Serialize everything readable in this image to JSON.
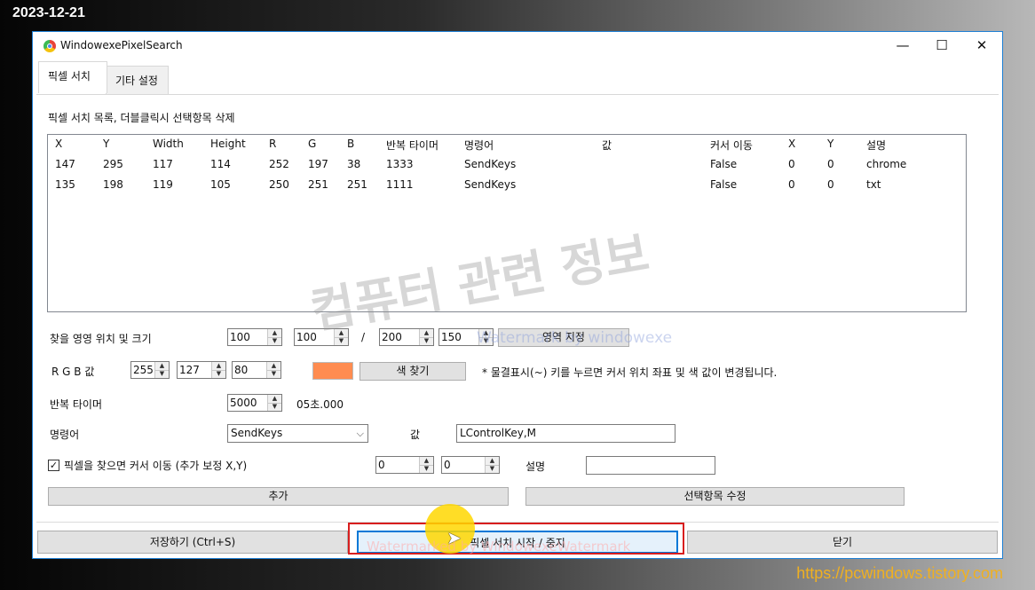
{
  "overlay": {
    "date": "2023-12-21",
    "site_url": "https://pcwindows.tistory.com",
    "watermark_main": "컴퓨터 관련 정보",
    "watermark_text_1": "Watermark by windowexe",
    "watermark_text_2": "Watermarked by WindowexeWatermark"
  },
  "window": {
    "title": "WindowexePixelSearch",
    "icon": "chrome-like-app-icon",
    "controls": {
      "minimize": "—",
      "maximize": "☐",
      "close": "✕"
    }
  },
  "tabs": [
    {
      "label": "픽셀 서치",
      "active": true
    },
    {
      "label": "기타 설정",
      "active": false
    }
  ],
  "main": {
    "list_caption": "픽셀 서치 목록, 더블클릭시 선택항목 삭제",
    "columns": [
      "X",
      "Y",
      "Width",
      "Height",
      "R",
      "G",
      "B",
      "반복 타이머",
      "명령어",
      "값",
      "커서 이동",
      "X",
      "Y",
      "설명"
    ],
    "rows": [
      [
        "147",
        "295",
        "117",
        "114",
        "252",
        "197",
        "38",
        "1333",
        "SendKeys",
        "",
        "False",
        "0",
        "0",
        "chrome"
      ],
      [
        "135",
        "198",
        "119",
        "105",
        "250",
        "251",
        "251",
        "1111",
        "SendKeys",
        "",
        "False",
        "0",
        "0",
        "txt"
      ]
    ],
    "area_label": "찾을 영영 위치 및 크기",
    "area_x": "100",
    "area_y": "100",
    "area_sep": "/",
    "area_w": "200",
    "area_h": "150",
    "area_button": "영역 지정",
    "rgb_label": "R G B 값",
    "rgb_r": "255",
    "rgb_g": "127",
    "rgb_b": "80",
    "rgb_swatch_color": "#ff8c50",
    "color_find_button": "색 찾기",
    "rgb_hint": "* 물결표시(~) 키를 누르면 커서 위치 좌표 및 색 값이 변경됩니다.",
    "timer_label": "반복 타이머",
    "timer_value": "5000",
    "timer_text": "05초.000",
    "command_label": "명령어",
    "command_value": "SendKeys",
    "value_label": "값",
    "value_input": "LControlKey,M",
    "move_cursor_checked": true,
    "move_cursor_label": "픽셀을 찾으면 커서 이동 (추가 보정 X,Y)",
    "offset_x": "0",
    "offset_y": "0",
    "desc_label": "설명",
    "desc_value": "",
    "add_button": "추가",
    "edit_button": "선택항목 수정"
  },
  "footer": {
    "save_button": "저장하기 (Ctrl+S)",
    "start_button": "픽셀 서치 시작 / 중지",
    "close_button": "닫기"
  }
}
